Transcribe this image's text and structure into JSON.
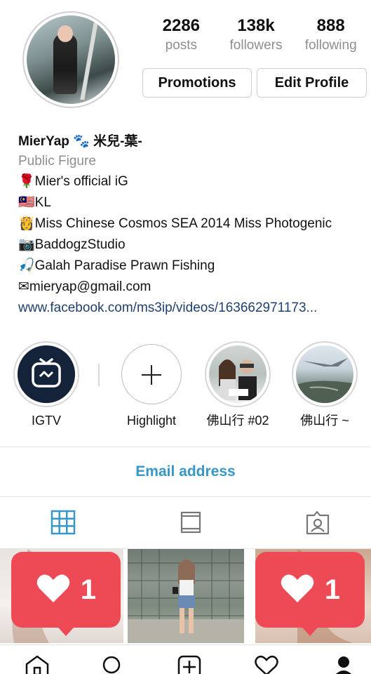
{
  "profile": {
    "stats": [
      {
        "value": "2286",
        "label": "posts"
      },
      {
        "value": "138k",
        "label": "followers"
      },
      {
        "value": "888",
        "label": "following"
      }
    ],
    "buttons": {
      "promotions": "Promotions",
      "edit_profile": "Edit Profile"
    },
    "bio": {
      "name": "MierYap 🐾 米兒-葉-",
      "category": "Public Figure",
      "lines": [
        "🌹Mier's official iG",
        "🇲🇾KL",
        "👸Miss Chinese Cosmos SEA 2014 Miss Photogenic",
        "📷BaddogzStudio",
        "🎣Galah Paradise Prawn Fishing",
        "✉mieryap@gmail.com"
      ],
      "link": "www.facebook.com/ms3ip/videos/163662971173..."
    }
  },
  "highlights": [
    {
      "label": "IGTV",
      "icon": "igtv-icon"
    },
    {
      "label": "Highlight",
      "icon": "plus-icon"
    },
    {
      "label": "佛山行 #02",
      "icon": "photo-thumbnail"
    },
    {
      "label": "佛山行 ~",
      "icon": "photo-thumbnail"
    }
  ],
  "contact": {
    "email_button": "Email address"
  },
  "tabs": [
    {
      "name": "grid",
      "icon": "grid-icon",
      "active": true
    },
    {
      "name": "feed",
      "icon": "feed-icon",
      "active": false
    },
    {
      "name": "tagged",
      "icon": "tagged-icon",
      "active": false
    }
  ],
  "notifications": [
    {
      "count": "1",
      "icon": "heart-icon"
    },
    {
      "count": "1",
      "icon": "heart-icon"
    }
  ],
  "bottom_nav": [
    "home-icon",
    "search-icon",
    "add-icon",
    "activity-heart-icon",
    "profile-icon"
  ],
  "colors": {
    "link": "#1f3f6e",
    "email": "#3897c9",
    "notification": "#ee4a56",
    "active_tab": "#3897c9"
  }
}
